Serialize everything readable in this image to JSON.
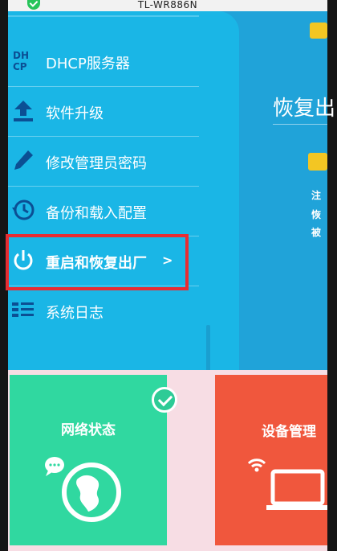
{
  "window": {
    "title": "TL-WR886N"
  },
  "menu": {
    "items": [
      {
        "label": "DHCP服务器",
        "icon": "dhcp-icon"
      },
      {
        "label": "软件升级",
        "icon": "upload-icon"
      },
      {
        "label": "修改管理员密码",
        "icon": "pencil-icon"
      },
      {
        "label": "备份和载入配置",
        "icon": "clock-icon"
      },
      {
        "label": "重启和恢复出厂",
        "icon": "power-icon",
        "chevron": ">",
        "active": true
      },
      {
        "label": "系统日志",
        "icon": "list-icon"
      }
    ]
  },
  "right_panel": {
    "heading": "恢复出",
    "fragments": [
      "注",
      "恢",
      "被"
    ]
  },
  "cards": {
    "network": {
      "title": "网络状态",
      "icon": "globe-icon"
    },
    "device": {
      "title": "设备管理",
      "icon": "laptop-icon"
    }
  },
  "colors": {
    "menu_bg": "#1ab6e6",
    "highlight": "#e82c32",
    "network_card": "#30d8a0",
    "device_card": "#f0573d",
    "badge": "#f3c623"
  }
}
